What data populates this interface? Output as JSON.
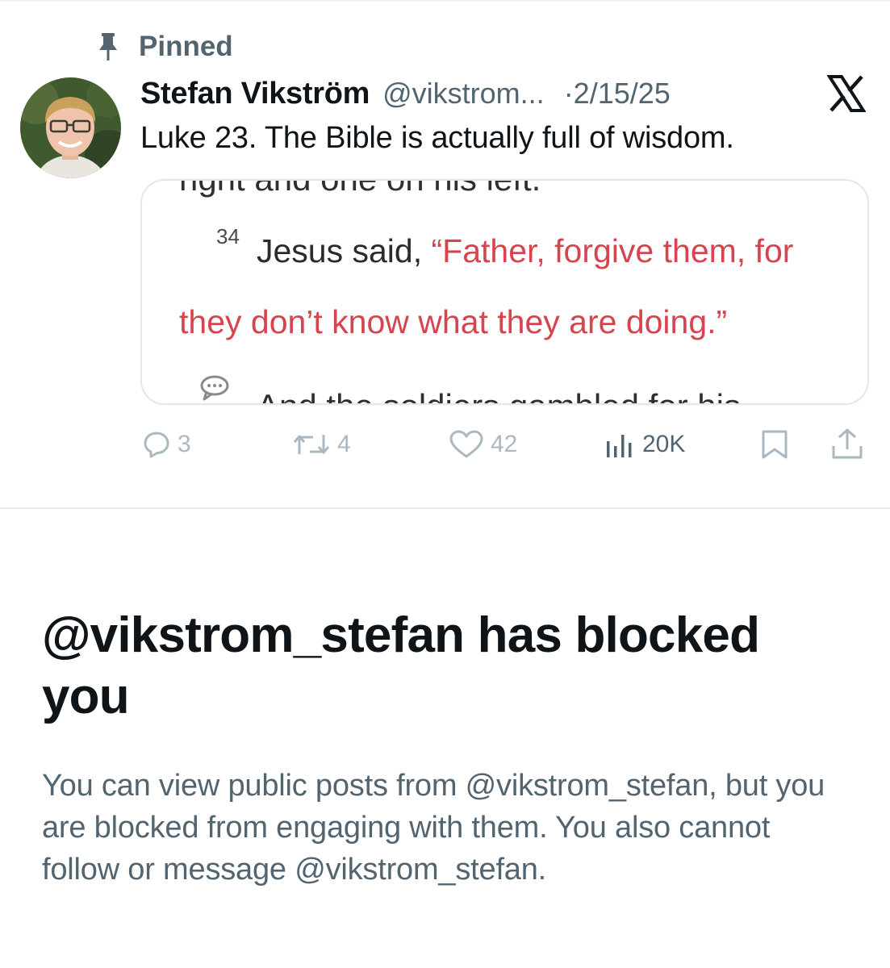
{
  "post": {
    "pinned_label": "Pinned",
    "author_name": "Stefan Vikström",
    "author_handle": "@vikstrom...",
    "date": "·2/15/25",
    "text": "Luke 23. The Bible is actually full of wisdom.",
    "media": {
      "cut_top_text": "right and one on his left.",
      "verse_number": "34",
      "verse_intro": "Jesus said, ",
      "verse_quote_line1": "“Father, forgive them, for",
      "verse_quote_line2": "they don’t know what they are doing.”",
      "cut_bottom_text": "And the soldiers gambled for his"
    },
    "actions": {
      "replies": "3",
      "reposts": "4",
      "likes": "42",
      "views": "20K"
    }
  },
  "blocked": {
    "title": "@vikstrom_stefan has blocked you",
    "description": "You can view public posts from @vikstrom_stefan, but you are blocked from engaging with them. You also cannot follow or message @vikstrom_stefan."
  },
  "colors": {
    "text_primary": "#0f1419",
    "text_secondary": "#536471",
    "action_disabled": "#aab8c2",
    "verse_red": "#d6444f",
    "card_border": "#e1e8ed"
  },
  "icons": [
    "pin-icon",
    "x-logo-icon",
    "reply-icon",
    "repost-icon",
    "like-icon",
    "views-icon",
    "bookmark-icon",
    "share-icon",
    "note-icon"
  ]
}
